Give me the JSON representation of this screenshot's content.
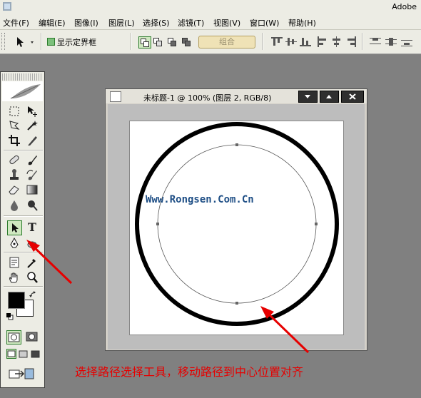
{
  "app": {
    "brand": "Adobe"
  },
  "menu": [
    "文件(F)",
    "编辑(E)",
    "图像(I)",
    "图层(L)",
    "选择(S)",
    "滤镜(T)",
    "视图(V)",
    "窗口(W)",
    "帮助(H)"
  ],
  "options": {
    "show_bounding_box": "显示定界框",
    "combine_button": "组合"
  },
  "document": {
    "title": "未标题-1 @ 100% (图层 2, RGB/8)",
    "watermark": "Www.Rongsen.Com.Cn",
    "window_buttons": [
      "minimize",
      "maximize",
      "close"
    ]
  },
  "tools": {
    "type_tool_glyph": "T"
  },
  "caption": "选择路径选择工具，移动路径到中心位置对齐",
  "colors": {
    "ui_bg": "#ecece4",
    "workspace": "#808080",
    "annotation": "#e60000",
    "watermark": "#1f4f86",
    "active_tool": "#2e7d2e"
  }
}
